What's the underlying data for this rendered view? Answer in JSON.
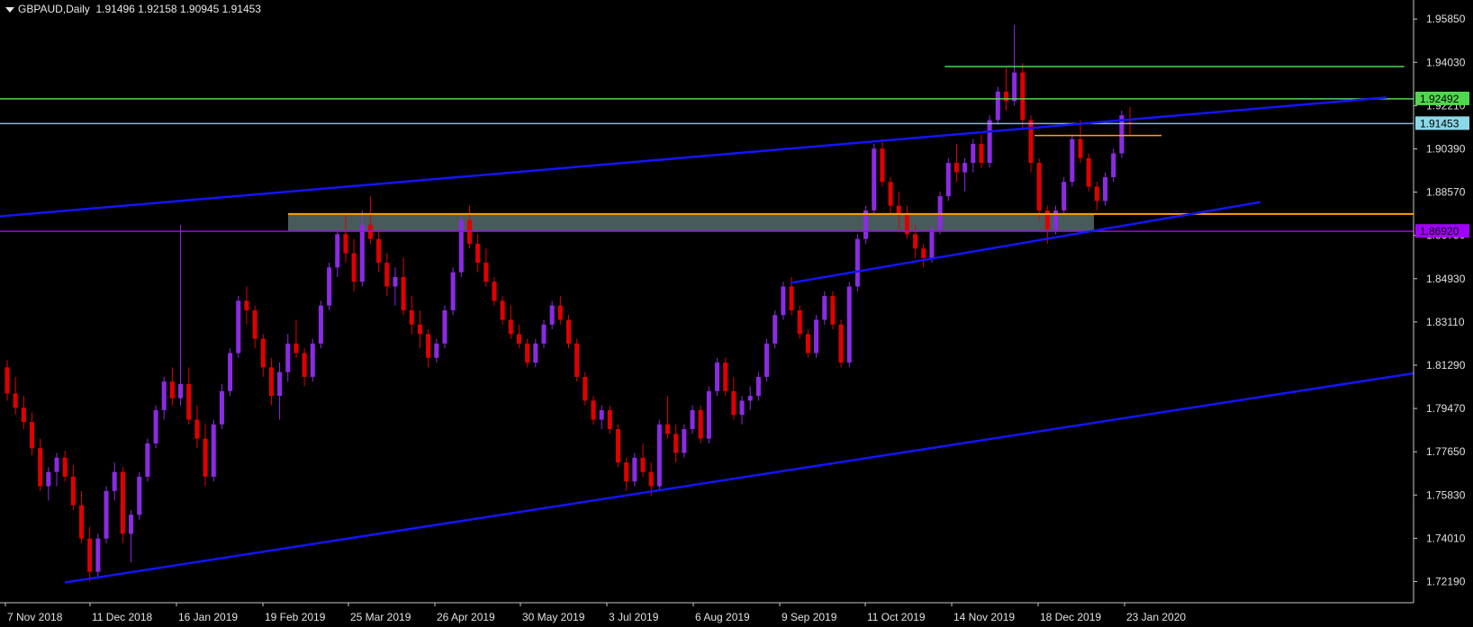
{
  "header": {
    "symbol_timeframe": "GBPAUD,Daily",
    "ohlc": "1.91496 1.92158 1.90945 1.91453"
  },
  "colors": {
    "background": "#000000",
    "axis": "#c8c8c8",
    "bull": "#8b2be2",
    "bear": "#e00000",
    "trendline": "#1414ff",
    "support": "#ffa000",
    "zone": "#556b6b",
    "horizontal_green": "#4fd84f",
    "horizontal_purple": "#a000ff",
    "bid_line": "#8ab4d8"
  },
  "chart_data": {
    "type": "candlestick",
    "symbol": "GBPAUD",
    "timeframe": "Daily",
    "ylim": [
      1.713,
      1.965
    ],
    "y_ticks": [
      "1.95850",
      "1.94030",
      "1.92210",
      "1.90390",
      "1.88570",
      "1.86750",
      "1.84930",
      "1.83110",
      "1.81290",
      "1.79470",
      "1.77650",
      "1.75830",
      "1.74010",
      "1.72190"
    ],
    "x_ticks": [
      "7 Nov 2018",
      "11 Dec 2018",
      "16 Jan 2019",
      "19 Feb 2019",
      "25 Mar 2019",
      "26 Apr 2019",
      "30 May 2019",
      "3 Jul 2019",
      "6 Aug 2019",
      "9 Sep 2019",
      "11 Oct 2019",
      "14 Nov 2019",
      "18 Dec 2019",
      "23 Jan 2020"
    ],
    "price_labels": [
      {
        "value": 1.92492,
        "label": "1.92492",
        "color": "#4fd84f"
      },
      {
        "value": 1.91453,
        "label": "1.91453",
        "color": "#8ad8e8"
      },
      {
        "value": 1.8692,
        "label": "1.86920",
        "color": "#a000ff"
      }
    ],
    "horizontal_lines": [
      {
        "value": 1.92492,
        "color": "#4fd84f"
      },
      {
        "value": 1.91453,
        "color": "#8ab4d8"
      },
      {
        "value": 1.8692,
        "color": "#a000ff"
      }
    ],
    "short_lines": [
      {
        "value": 1.9385,
        "x_start": "Nov 2019",
        "x_end": "Jan 2020",
        "color": "#4fd84f"
      },
      {
        "value": 1.9095,
        "x_start": "Dec 2019",
        "x_end": "Jan 2020",
        "color": "#ffa000"
      }
    ],
    "zone": {
      "top": 1.8765,
      "bottom": 1.8692,
      "color": "#556b6b",
      "edge_color": "#ffa000"
    },
    "trendlines": [
      {
        "from": [
          0,
          1.8755
        ],
        "to": [
          1.0,
          1.9255
        ]
      },
      {
        "from": [
          0.08,
          1.7215
        ],
        "to": [
          1.0,
          1.8095
        ]
      },
      {
        "from": [
          0.53,
          1.8475
        ],
        "to": [
          0.86,
          1.8815
        ]
      }
    ],
    "candles_ohlc": [
      [
        1.812,
        1.815,
        1.798,
        1.801
      ],
      [
        1.801,
        1.808,
        1.792,
        1.795
      ],
      [
        1.795,
        1.8,
        1.786,
        1.789
      ],
      [
        1.789,
        1.793,
        1.775,
        1.778
      ],
      [
        1.778,
        1.782,
        1.76,
        1.762
      ],
      [
        1.762,
        1.77,
        1.756,
        1.768
      ],
      [
        1.768,
        1.776,
        1.762,
        1.774
      ],
      [
        1.774,
        1.777,
        1.764,
        1.766
      ],
      [
        1.766,
        1.771,
        1.752,
        1.754
      ],
      [
        1.754,
        1.76,
        1.738,
        1.74
      ],
      [
        1.74,
        1.745,
        1.722,
        1.726
      ],
      [
        1.726,
        1.742,
        1.723,
        1.74
      ],
      [
        1.74,
        1.762,
        1.738,
        1.76
      ],
      [
        1.76,
        1.772,
        1.756,
        1.768
      ],
      [
        1.768,
        1.77,
        1.738,
        1.742
      ],
      [
        1.742,
        1.752,
        1.73,
        1.75
      ],
      [
        1.75,
        1.768,
        1.748,
        1.766
      ],
      [
        1.766,
        1.782,
        1.764,
        1.78
      ],
      [
        1.78,
        1.796,
        1.778,
        1.794
      ],
      [
        1.794,
        1.808,
        1.79,
        1.806
      ],
      [
        1.806,
        1.812,
        1.796,
        1.799
      ],
      [
        1.799,
        1.872,
        1.796,
        1.805
      ],
      [
        1.805,
        1.812,
        1.788,
        1.79
      ],
      [
        1.79,
        1.796,
        1.778,
        1.782
      ],
      [
        1.782,
        1.788,
        1.762,
        1.766
      ],
      [
        1.766,
        1.79,
        1.764,
        1.788
      ],
      [
        1.788,
        1.805,
        1.786,
        1.802
      ],
      [
        1.802,
        1.82,
        1.8,
        1.818
      ],
      [
        1.818,
        1.842,
        1.816,
        1.84
      ],
      [
        1.84,
        1.846,
        1.83,
        1.836
      ],
      [
        1.836,
        1.838,
        1.82,
        1.824
      ],
      [
        1.824,
        1.826,
        1.808,
        1.812
      ],
      [
        1.812,
        1.816,
        1.796,
        1.8
      ],
      [
        1.8,
        1.814,
        1.79,
        1.81
      ],
      [
        1.81,
        1.826,
        1.806,
        1.822
      ],
      [
        1.822,
        1.832,
        1.816,
        1.818
      ],
      [
        1.818,
        1.82,
        1.804,
        1.808
      ],
      [
        1.808,
        1.824,
        1.806,
        1.822
      ],
      [
        1.822,
        1.84,
        1.82,
        1.838
      ],
      [
        1.838,
        1.856,
        1.836,
        1.854
      ],
      [
        1.854,
        1.87,
        1.85,
        1.868
      ],
      [
        1.868,
        1.876,
        1.856,
        1.86
      ],
      [
        1.86,
        1.866,
        1.844,
        1.848
      ],
      [
        1.848,
        1.878,
        1.846,
        1.872
      ],
      [
        1.872,
        1.884,
        1.864,
        1.866
      ],
      [
        1.866,
        1.87,
        1.852,
        1.856
      ],
      [
        1.856,
        1.86,
        1.842,
        1.846
      ],
      [
        1.846,
        1.854,
        1.838,
        1.85
      ],
      [
        1.85,
        1.858,
        1.834,
        1.836
      ],
      [
        1.836,
        1.842,
        1.826,
        1.83
      ],
      [
        1.83,
        1.836,
        1.82,
        1.826
      ],
      [
        1.826,
        1.828,
        1.812,
        1.816
      ],
      [
        1.816,
        1.824,
        1.814,
        1.822
      ],
      [
        1.822,
        1.838,
        1.82,
        1.836
      ],
      [
        1.836,
        1.854,
        1.834,
        1.852
      ],
      [
        1.852,
        1.876,
        1.85,
        1.874
      ],
      [
        1.874,
        1.88,
        1.862,
        1.864
      ],
      [
        1.864,
        1.868,
        1.852,
        1.856
      ],
      [
        1.856,
        1.862,
        1.846,
        1.848
      ],
      [
        1.848,
        1.85,
        1.838,
        1.84
      ],
      [
        1.84,
        1.842,
        1.83,
        1.832
      ],
      [
        1.832,
        1.838,
        1.824,
        1.826
      ],
      [
        1.826,
        1.83,
        1.82,
        1.822
      ],
      [
        1.822,
        1.824,
        1.812,
        1.814
      ],
      [
        1.814,
        1.824,
        1.812,
        1.822
      ],
      [
        1.822,
        1.832,
        1.82,
        1.83
      ],
      [
        1.83,
        1.84,
        1.828,
        1.838
      ],
      [
        1.838,
        1.842,
        1.83,
        1.832
      ],
      [
        1.832,
        1.834,
        1.82,
        1.822
      ],
      [
        1.822,
        1.824,
        1.806,
        1.808
      ],
      [
        1.808,
        1.81,
        1.796,
        1.798
      ],
      [
        1.798,
        1.8,
        1.788,
        1.79
      ],
      [
        1.79,
        1.796,
        1.786,
        1.794
      ],
      [
        1.794,
        1.796,
        1.784,
        1.786
      ],
      [
        1.786,
        1.788,
        1.77,
        1.772
      ],
      [
        1.772,
        1.774,
        1.76,
        1.764
      ],
      [
        1.764,
        1.776,
        1.762,
        1.774
      ],
      [
        1.774,
        1.78,
        1.766,
        1.768
      ],
      [
        1.768,
        1.772,
        1.758,
        1.762
      ],
      [
        1.762,
        1.79,
        1.76,
        1.788
      ],
      [
        1.788,
        1.8,
        1.782,
        1.784
      ],
      [
        1.784,
        1.788,
        1.772,
        1.776
      ],
      [
        1.776,
        1.788,
        1.774,
        1.786
      ],
      [
        1.786,
        1.796,
        1.784,
        1.794
      ],
      [
        1.794,
        1.796,
        1.78,
        1.782
      ],
      [
        1.782,
        1.804,
        1.78,
        1.802
      ],
      [
        1.802,
        1.816,
        1.8,
        1.814
      ],
      [
        1.814,
        1.816,
        1.8,
        1.802
      ],
      [
        1.802,
        1.808,
        1.79,
        1.792
      ],
      [
        1.792,
        1.8,
        1.788,
        1.798
      ],
      [
        1.798,
        1.804,
        1.794,
        1.8
      ],
      [
        1.8,
        1.81,
        1.798,
        1.808
      ],
      [
        1.808,
        1.824,
        1.806,
        1.822
      ],
      [
        1.822,
        1.836,
        1.82,
        1.834
      ],
      [
        1.834,
        1.848,
        1.832,
        1.846
      ],
      [
        1.846,
        1.85,
        1.834,
        1.836
      ],
      [
        1.836,
        1.838,
        1.824,
        1.826
      ],
      [
        1.826,
        1.828,
        1.816,
        1.818
      ],
      [
        1.818,
        1.834,
        1.816,
        1.832
      ],
      [
        1.832,
        1.844,
        1.83,
        1.842
      ],
      [
        1.842,
        1.844,
        1.828,
        1.83
      ],
      [
        1.83,
        1.832,
        1.812,
        1.814
      ],
      [
        1.814,
        1.848,
        1.812,
        1.846
      ],
      [
        1.846,
        1.868,
        1.844,
        1.866
      ],
      [
        1.866,
        1.88,
        1.864,
        1.878
      ],
      [
        1.878,
        1.906,
        1.876,
        1.904
      ],
      [
        1.904,
        1.908,
        1.888,
        1.89
      ],
      [
        1.89,
        1.892,
        1.876,
        1.88
      ],
      [
        1.88,
        1.886,
        1.87,
        1.876
      ],
      [
        1.876,
        1.88,
        1.866,
        1.868
      ],
      [
        1.868,
        1.872,
        1.858,
        1.862
      ],
      [
        1.862,
        1.864,
        1.854,
        1.858
      ],
      [
        1.858,
        1.872,
        1.856,
        1.87
      ],
      [
        1.87,
        1.886,
        1.868,
        1.884
      ],
      [
        1.884,
        1.9,
        1.882,
        1.898
      ],
      [
        1.898,
        1.906,
        1.89,
        1.894
      ],
      [
        1.894,
        1.9,
        1.886,
        1.898
      ],
      [
        1.898,
        1.908,
        1.894,
        1.906
      ],
      [
        1.906,
        1.91,
        1.896,
        1.898
      ],
      [
        1.898,
        1.918,
        1.896,
        1.916
      ],
      [
        1.916,
        1.93,
        1.914,
        1.928
      ],
      [
        1.928,
        1.938,
        1.92,
        1.924
      ],
      [
        1.924,
        1.956,
        1.922,
        1.936
      ],
      [
        1.936,
        1.94,
        1.912,
        1.916
      ],
      [
        1.916,
        1.918,
        1.894,
        1.898
      ],
      [
        1.898,
        1.9,
        1.874,
        1.878
      ],
      [
        1.878,
        1.88,
        1.864,
        1.87
      ],
      [
        1.87,
        1.88,
        1.868,
        1.878
      ],
      [
        1.878,
        1.892,
        1.876,
        1.89
      ],
      [
        1.89,
        1.91,
        1.888,
        1.908
      ],
      [
        1.908,
        1.916,
        1.898,
        1.9
      ],
      [
        1.9,
        1.902,
        1.886,
        1.888
      ],
      [
        1.888,
        1.89,
        1.878,
        1.882
      ],
      [
        1.882,
        1.894,
        1.88,
        1.892
      ],
      [
        1.892,
        1.904,
        1.89,
        1.902
      ],
      [
        1.902,
        1.92,
        1.9,
        1.918
      ],
      [
        1.915,
        1.9216,
        1.9095,
        1.9145
      ]
    ]
  }
}
